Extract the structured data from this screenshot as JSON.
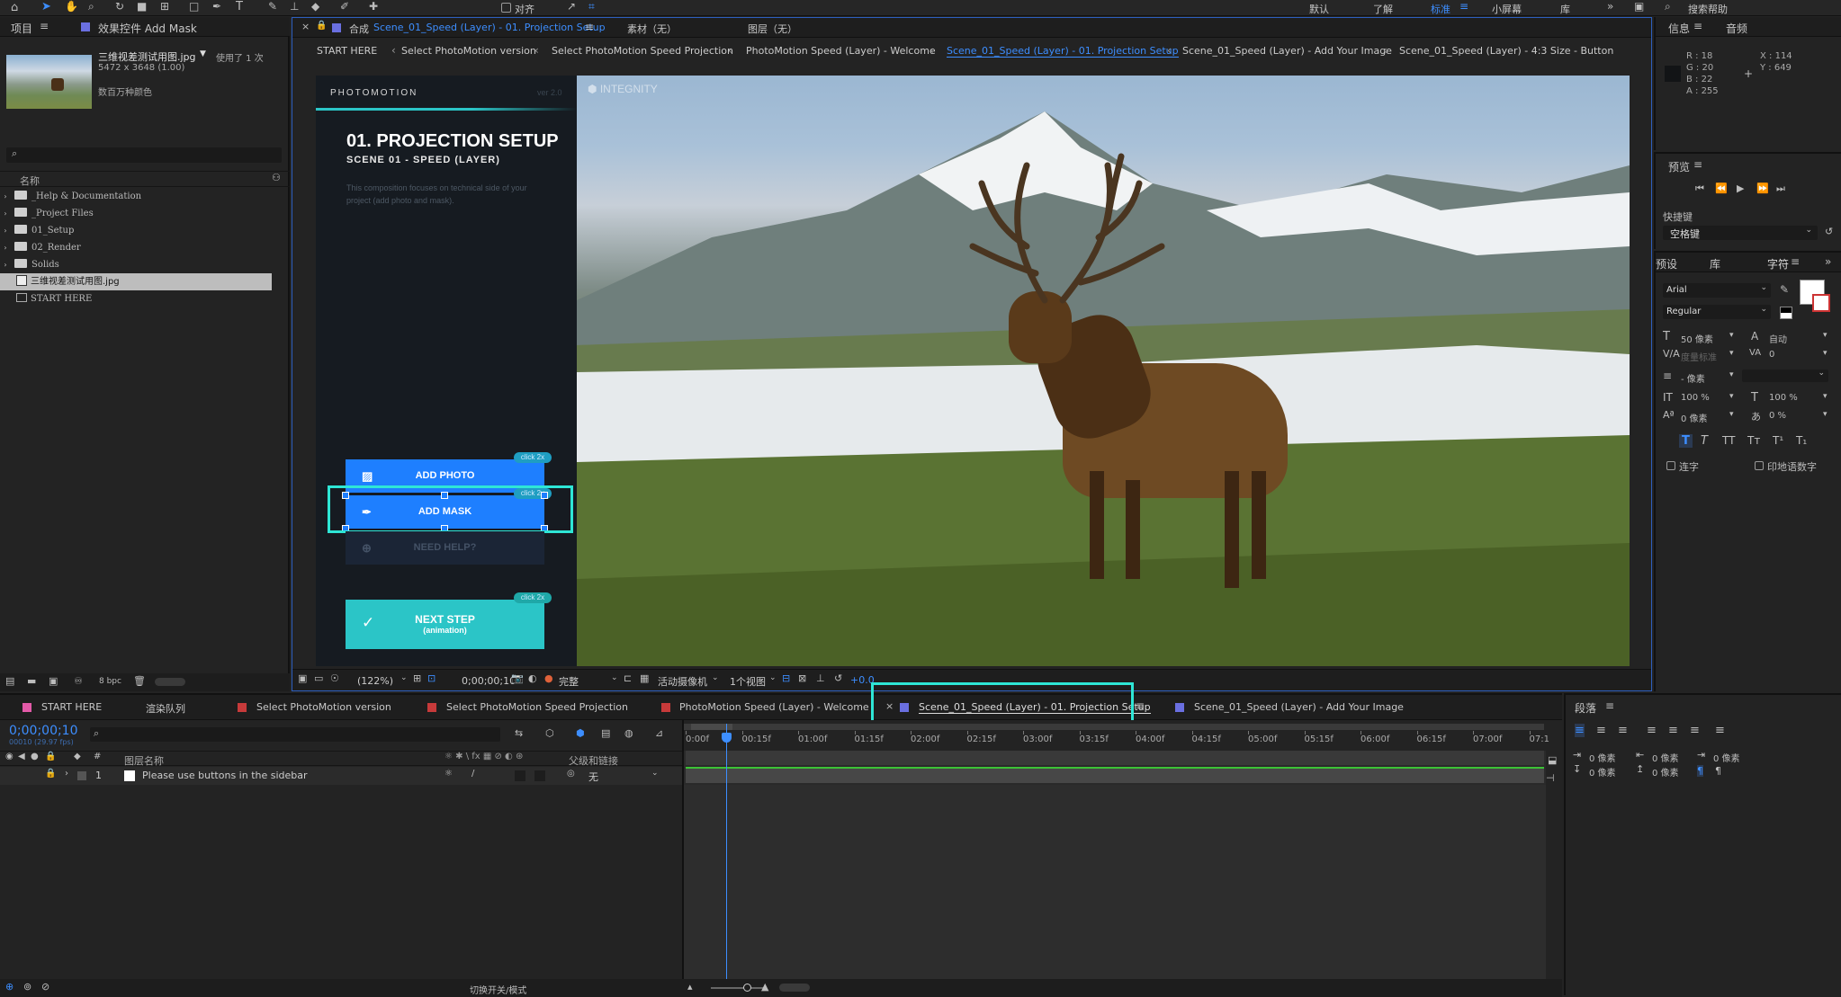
{
  "topbar": {
    "checkbox_align_label": "对齐",
    "workspaces": [
      "默认",
      "了解",
      "标准",
      "小屏幕",
      "库"
    ],
    "active_workspace": "标准",
    "search_placeholder": "搜索帮助"
  },
  "project_panel": {
    "tab_project": "项目",
    "tab_effects": "效果控件 Add Mask",
    "selected_file": "三维视差测试用图.jpg",
    "used_times": "使用了 1 次",
    "dimensions": "5472 x 3648 (1.00)",
    "colors": "数百万种颜色",
    "column_name": "名称",
    "items": [
      {
        "label": "_Help & Documentation",
        "type": "folder"
      },
      {
        "label": "_Project Files",
        "type": "folder"
      },
      {
        "label": "01_Setup",
        "type": "folder"
      },
      {
        "label": "02_Render",
        "type": "folder"
      },
      {
        "label": "Solids",
        "type": "folder"
      },
      {
        "label": "三维视差测试用图.jpg",
        "type": "image"
      },
      {
        "label": "START HERE",
        "type": "comp"
      }
    ],
    "bpc": "8 bpc"
  },
  "comp_viewer": {
    "tab_comp_prefix": "合成",
    "tab_comp_name": "Scene_01_Speed (Layer) - 01. Projection Setup",
    "tab_footage": "素材（无）",
    "tab_layer": "图层（无）",
    "breadcrumbs": [
      "START HERE",
      "Select PhotoMotion version",
      "Select PhotoMotion Speed Projection",
      "PhotoMotion Speed (Layer) - Welcome",
      "Scene_01_Speed (Layer) - 01. Projection Setup",
      "Scene_01_Speed (Layer) - Add Your Image",
      "Scene_01_Speed (Layer) - 4:3 Size - Button"
    ],
    "active_crumb": 4,
    "zoom": "(122%)",
    "timecode": "0;00;00;10",
    "resolution": "完整",
    "camera": "活动摄像机",
    "views": "1个视图",
    "exposure": "+0.0"
  },
  "photomotion_ui": {
    "brand": "PHOTOMOTION",
    "version": "ver 2.0",
    "title": "01. PROJECTION SETUP",
    "subtitle": "SCENE 01 - SPEED (LAYER)",
    "description": "This composition focuses on technical side of your project (add photo and mask).",
    "btn_add_photo": "ADD PHOTO",
    "btn_add_mask": "ADD MASK",
    "btn_need_help": "NEED HELP?",
    "click_tag": "click 2x",
    "btn_next_step": "NEXT STEP",
    "btn_next_sub": "(animation)",
    "watermark": "INTEGNITY"
  },
  "info_panel": {
    "tab_info": "信息",
    "tab_audio": "音频",
    "r": "R : 18",
    "g": "G : 20",
    "b": "B : 22",
    "a": "A : 255",
    "x": "X : 114",
    "y": "Y : 649"
  },
  "preview_panel": {
    "title": "预览",
    "shortcut_label": "快捷键",
    "shortcut_value": "空格键"
  },
  "character_panel": {
    "tab_presets": "预设",
    "tab_library": "库",
    "tab_character": "字符",
    "font": "Arial",
    "style": "Regular",
    "size": "50 像素",
    "leading": "自动",
    "kerning": "度量标准",
    "tracking": "0",
    "stroke": "- 像素",
    "vscale": "100 %",
    "hscale": "100 %",
    "baseline": "0 像素",
    "tsume": "0 %",
    "ligatures": "连字",
    "hindi_digits": "印地语数字"
  },
  "timeline": {
    "tabs": [
      {
        "label": "START HERE",
        "color": "#e35aa8"
      },
      {
        "label": "渲染队列",
        "color": ""
      },
      {
        "label": "Select PhotoMotion version",
        "color": "#c73a3a"
      },
      {
        "label": "Select PhotoMotion Speed Projection",
        "color": "#c73a3a"
      },
      {
        "label": "PhotoMotion Speed (Layer) - Welcome",
        "color": "#c73a3a"
      },
      {
        "label": "Scene_01_Speed (Layer) - 01. Projection Setup",
        "color": "#6a6fe0"
      },
      {
        "label": "Scene_01_Speed (Layer) - Add Your Image",
        "color": "#6a6fe0"
      }
    ],
    "timecode": "0;00;00;10",
    "frame_info": "00010 (29.97 fps)",
    "col_layer_name": "图层名称",
    "col_parent": "父级和链接",
    "layer_number": "1",
    "layer_name": "Please use buttons in the sidebar",
    "layer_parent": "无",
    "ruler": [
      "0:00f",
      "00:15f",
      "01:00f",
      "01:15f",
      "02:00f",
      "02:15f",
      "03:00f",
      "03:15f",
      "04:00f",
      "04:15f",
      "05:00f",
      "05:15f",
      "06:00f",
      "06:15f",
      "07:00f",
      "07:1"
    ],
    "bottom_toggle": "切换开关/模式"
  },
  "paragraph_panel": {
    "title": "段落",
    "indent_left": "0 像素",
    "indent_right": "0 像素",
    "indent_first": "0 像素",
    "space_before": "0 像素",
    "space_after": "0 像素"
  },
  "colors": {
    "accent": "#2d8ceb",
    "highlight": "#2ee6d6",
    "photomotion_blue": "#1e7fff",
    "next_step_teal": "#2bc5c7"
  }
}
